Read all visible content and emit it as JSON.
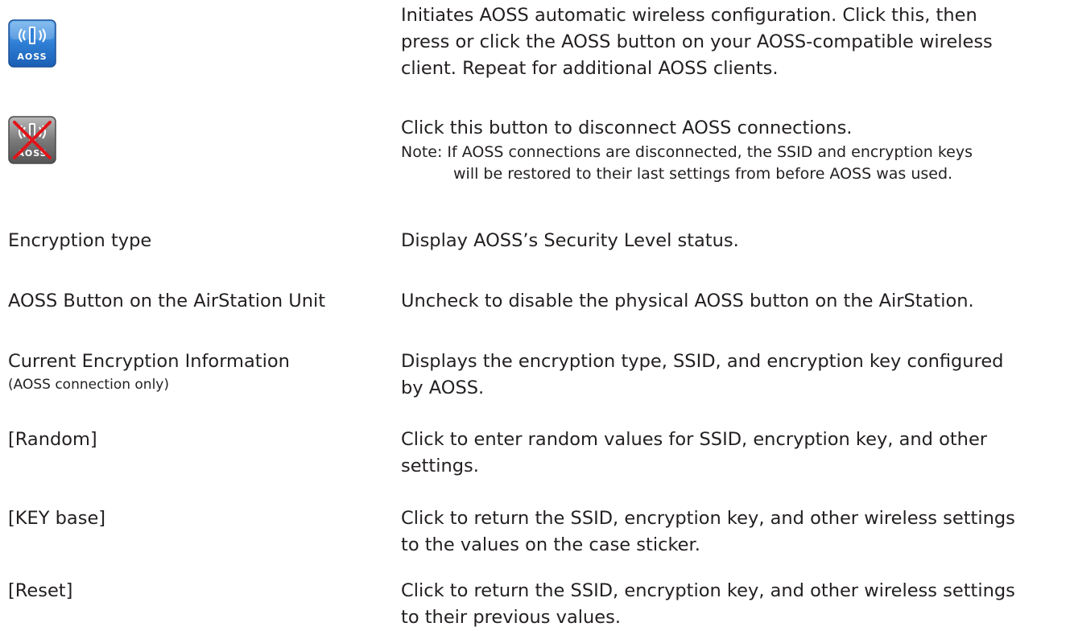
{
  "aoss_button": {
    "icon": "aoss-icon",
    "icon_text": "AOSS",
    "desc_lines": [
      "Initiates AOSS automatic wireless configuration. Click this, then",
      "press or click the AOSS button on your AOSS-compatible wireless",
      "client. Repeat for additional AOSS clients."
    ]
  },
  "disconnect_button": {
    "icon": "aoss-disconnect-icon",
    "icon_text": "AOSS",
    "desc": "Click this button to disconnect AOSS connections.",
    "note_line1": "Note: If AOSS connections are disconnected, the SSID and encryption keys",
    "note_line2": "will be restored to their last settings from before AOSS was used."
  },
  "rows": [
    {
      "term": "Encryption type",
      "desc_lines": [
        "Display AOSS’s Security Level status."
      ]
    },
    {
      "term": "AOSS Button on the AirStation Unit",
      "desc_lines": [
        "Uncheck to disable the physical AOSS button on the AirStation."
      ]
    },
    {
      "term": "Current Encryption Information",
      "term_sub": "(AOSS connection only)",
      "desc_lines": [
        "Displays the encryption type, SSID, and encryption key configured",
        "by AOSS."
      ]
    },
    {
      "term": "[Random]",
      "desc_lines": [
        "Click to enter random values for SSID, encryption key, and other",
        "settings."
      ]
    },
    {
      "term": "[KEY base]",
      "desc_lines": [
        "Click to return the SSID, encryption key, and other wireless settings",
        "to the values on the case sticker."
      ]
    },
    {
      "term": "[Reset]",
      "desc_lines": [
        "Click to return the SSID, encryption key, and other wireless settings",
        "to their previous values."
      ]
    }
  ],
  "colors": {
    "text": "#231f20",
    "icon_blue": "#2f7fd6",
    "icon_gray": "#7a7a7a",
    "cross_red": "#e0141b"
  }
}
